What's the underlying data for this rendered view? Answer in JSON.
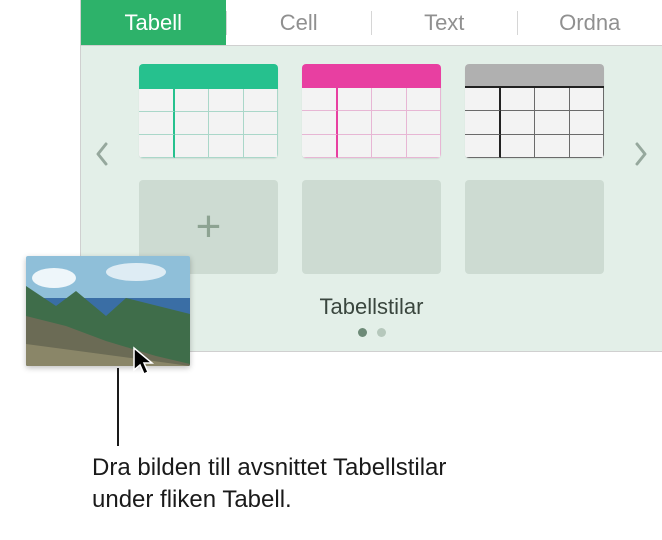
{
  "tabs": {
    "tabell": "Tabell",
    "cell": "Cell",
    "text": "Text",
    "ordna": "Ordna"
  },
  "styles": {
    "label": "Tabellstilar",
    "thumbs": [
      {
        "accent": "#26c18e"
      },
      {
        "accent": "#e83fa1"
      },
      {
        "accent": "#b0b0b0"
      }
    ],
    "add_symbol": "+"
  },
  "callout": {
    "line1": "Dra bilden till avsnittet Tabellstilar",
    "line2": "under fliken Tabell."
  }
}
